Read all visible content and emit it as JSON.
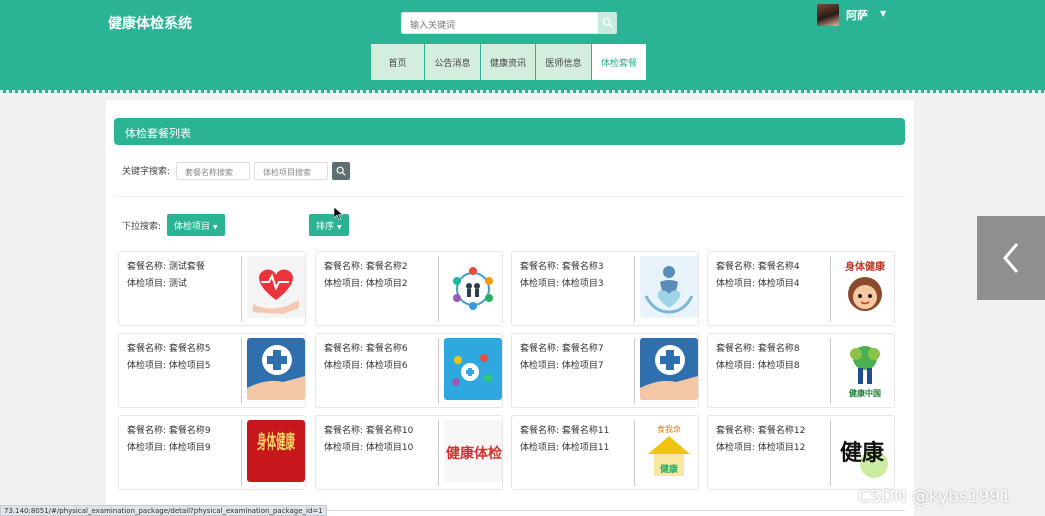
{
  "header": {
    "brand": "健康体检系统",
    "search_placeholder": "输入关键词",
    "user_name": "阿萨",
    "accent": "#2ab394"
  },
  "nav": [
    {
      "label": "首页",
      "active": false
    },
    {
      "label": "公告消息",
      "active": false
    },
    {
      "label": "健康资讯",
      "active": false
    },
    {
      "label": "医师信息",
      "active": false
    },
    {
      "label": "体检套餐",
      "active": true
    }
  ],
  "section": {
    "title": "体检套餐列表",
    "keyword_label": "关键字搜索:",
    "name_placeholder": "套餐名称搜索",
    "item_placeholder": "体检项目搜索",
    "dropdown_label": "下拉搜索:",
    "dropdown_items_label": "体检项目",
    "sort_label": "排序"
  },
  "cards": [
    {
      "name": "套餐名称: 测试套餐",
      "item": "体检项目: 测试",
      "image": "heart-hand-image"
    },
    {
      "name": "套餐名称: 套餐名称2",
      "item": "体检项目: 体检项目2",
      "image": "medical-icons-image"
    },
    {
      "name": "套餐名称: 套餐名称3",
      "item": "体检项目: 体检项目3",
      "image": "heart-hands-image"
    },
    {
      "name": "套餐名称: 套餐名称4",
      "item": "体检项目: 体检项目4",
      "image": "health-cartoon-image"
    },
    {
      "name": "套餐名称: 套餐名称5",
      "item": "体检项目: 体检项目5",
      "image": "cross-hand-image"
    },
    {
      "name": "套餐名称: 套餐名称6",
      "item": "体检项目: 体检项目6",
      "image": "health-app-image"
    },
    {
      "name": "套餐名称: 套餐名称7",
      "item": "体检项目: 体检项目7",
      "image": "cross-hand-image"
    },
    {
      "name": "套餐名称: 套餐名称8",
      "item": "体检项目: 体检项目8",
      "image": "health-china-image"
    },
    {
      "name": "套餐名称: 套餐名称9",
      "item": "体检项目: 体检项目9",
      "image": "health-red-image"
    },
    {
      "name": "套餐名称: 套餐名称10",
      "item": "体检项目: 体检项目10",
      "image": "health-text-image"
    },
    {
      "name": "套餐名称: 套餐名称11",
      "item": "体检项目: 体检项目11",
      "image": "health-house-image"
    },
    {
      "name": "套餐名称: 套餐名称12",
      "item": "体检项目: 体检项目12",
      "image": "health-calligraphy-image"
    }
  ],
  "card_image_text": {
    "health_cartoon": "身体健康",
    "health_china": "健康中国",
    "health_red": "身体健康",
    "health_text": "健康体检",
    "health_house_top": "食我命",
    "health_house_bottom": "健康",
    "health_calligraphy": "健康"
  },
  "status_url": "73.140:8051/#/physical_examination_package/detail?physical_examination_package_id=1",
  "watermark": "CSDN @kybs1991"
}
